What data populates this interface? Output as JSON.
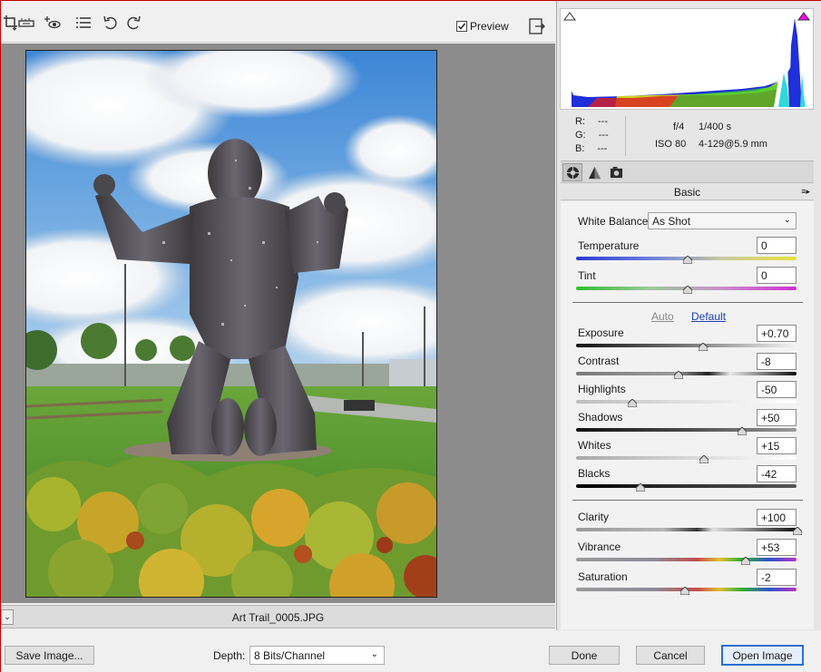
{
  "toolbar": {
    "tools": [
      "crop-tool-icon",
      "straighten-tool-icon",
      "red-eye-tool-icon",
      "list-icon",
      "rotate-left-icon",
      "rotate-right-icon"
    ],
    "preview_label": "Preview",
    "preview_checked": true
  },
  "status_bar": {
    "filename": "Art Trail_0005.JPG"
  },
  "info": {
    "r_label": "R:",
    "r_value": "---",
    "g_label": "G:",
    "g_value": "---",
    "b_label": "B:",
    "b_value": "---",
    "aperture": "f/4",
    "shutter": "1/400 s",
    "iso": "ISO 80",
    "lens": "4-129@5.9 mm"
  },
  "panel": {
    "title": "Basic",
    "tabs": [
      "basic-tab-icon",
      "tone-curve-tab-icon",
      "camera-calibration-tab-icon"
    ],
    "white_balance_label": "White Balance:",
    "white_balance_value": "As Shot",
    "auto_label": "Auto",
    "default_label": "Default",
    "sliders": [
      {
        "name": "temperature",
        "label": "Temperature",
        "value": "0",
        "position": 0.5
      },
      {
        "name": "tint",
        "label": "Tint",
        "value": "0",
        "position": 0.5
      },
      {
        "name": "exposure",
        "label": "Exposure",
        "value": "+0.70",
        "position": 0.57
      },
      {
        "name": "contrast",
        "label": "Contrast",
        "value": "-8",
        "position": 0.46
      },
      {
        "name": "highlights",
        "label": "Highlights",
        "value": "-50",
        "position": 0.25
      },
      {
        "name": "shadows",
        "label": "Shadows",
        "value": "+50",
        "position": 0.75
      },
      {
        "name": "whites",
        "label": "Whites",
        "value": "+15",
        "position": 0.575
      },
      {
        "name": "blacks",
        "label": "Blacks",
        "value": "-42",
        "position": 0.29
      },
      {
        "name": "clarity",
        "label": "Clarity",
        "value": "+100",
        "position": 1.0
      },
      {
        "name": "vibrance",
        "label": "Vibrance",
        "value": "+53",
        "position": 0.765
      },
      {
        "name": "saturation",
        "label": "Saturation",
        "value": "-2",
        "position": 0.49
      }
    ]
  },
  "bottom": {
    "save_label": "Save Image...",
    "depth_label": "Depth:",
    "depth_value": "8 Bits/Channel",
    "done_label": "Done",
    "cancel_label": "Cancel",
    "open_label": "Open Image"
  },
  "colors": {
    "clipping_shadow_indicator": "#ffffff",
    "clipping_highlight_indicator": "#ff00ff",
    "primary_button_border": "#2a6fd1"
  }
}
